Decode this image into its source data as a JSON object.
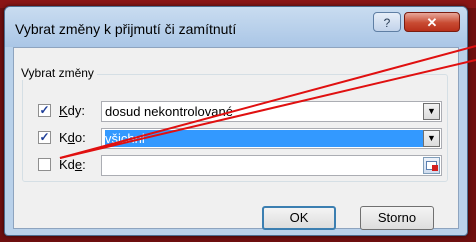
{
  "dialog": {
    "title": "Vybrat změny k přijmutí či zamítnutí",
    "help_label": "?",
    "close_label": "✕"
  },
  "group": {
    "label": "Vybrat změny"
  },
  "rows": [
    {
      "checked": true,
      "check_mark": "✓",
      "label_prefix": "",
      "label_underlined": "K",
      "label_suffix": "dy:",
      "value": "dosud nekontrolované",
      "control": "dropdown"
    },
    {
      "checked": true,
      "check_mark": "✓",
      "label_prefix": "K",
      "label_underlined": "d",
      "label_suffix": "o:",
      "value": "všichni",
      "control": "dropdown-selected"
    },
    {
      "checked": false,
      "check_mark": "",
      "label_prefix": "Kd",
      "label_underlined": "e",
      "label_suffix": ":",
      "value": "",
      "control": "range"
    }
  ],
  "buttons": {
    "ok": "OK",
    "storno": "Storno"
  },
  "icons": {
    "dropdown": "▼",
    "range_selector": "range-select-icon"
  },
  "colors": {
    "background": "#6e0f0f",
    "selection": "#3399ff",
    "annotation_line": "#e01010"
  }
}
